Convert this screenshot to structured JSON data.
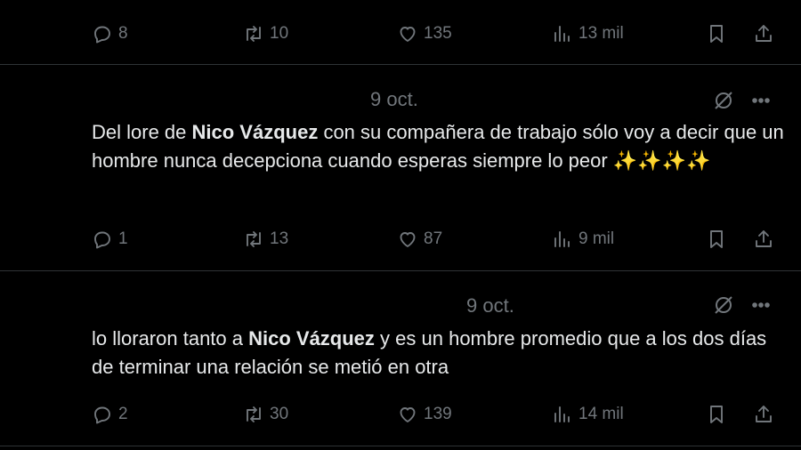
{
  "posts": [
    {
      "date": "",
      "text_before": "",
      "mention": "",
      "text_after": "",
      "replies": "8",
      "reposts": "10",
      "likes": "135",
      "views": "13 mil"
    },
    {
      "date": "9 oct.",
      "text_before": "Del lore de ",
      "mention": "Nico Vázquez",
      "text_after": " con su compañera de trabajo sólo voy a decir que un hombre nunca decepciona cuando esperas siempre lo peor ✨✨✨✨",
      "replies": "1",
      "reposts": "13",
      "likes": "87",
      "views": "9 mil"
    },
    {
      "date": "9 oct.",
      "text_before": "lo lloraron tanto a ",
      "mention": "Nico Vázquez",
      "text_after": " y es un hombre promedio que a los dos días de terminar una relación se metió en otra",
      "replies": "2",
      "reposts": "30",
      "likes": "139",
      "views": "14 mil"
    }
  ],
  "icons": {
    "reply": "reply-icon",
    "repost": "repost-icon",
    "like": "heart-icon",
    "views": "views-icon",
    "bookmark": "bookmark-icon",
    "share": "share-icon",
    "grok": "grok-icon",
    "more": "more-icon"
  },
  "colors": {
    "background": "#000000",
    "text": "#e7e9ea",
    "muted": "#71767b",
    "divider": "#2f3336"
  }
}
